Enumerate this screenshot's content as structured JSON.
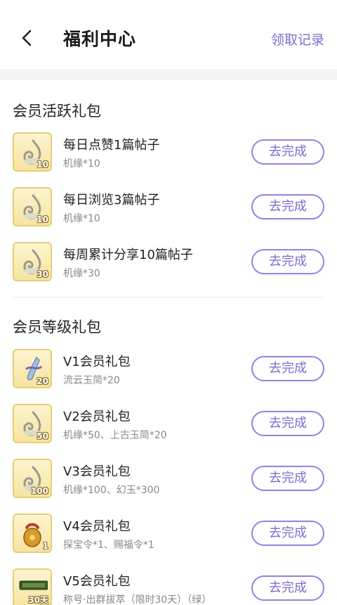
{
  "header": {
    "title": "福利中心",
    "records_label": "领取记录"
  },
  "sections": [
    {
      "title": "会员活跃礼包",
      "items": [
        {
          "title": "每日点赞1篇帖子",
          "reward": "机缘*10",
          "badge": "10",
          "button": "去完成",
          "icon": "swirl-token-icon"
        },
        {
          "title": "每日浏览3篇帖子",
          "reward": "机缘*10",
          "badge": "10",
          "button": "去完成",
          "icon": "swirl-token-icon"
        },
        {
          "title": "每周累计分享10篇帖子",
          "reward": "机缘*30",
          "badge": "30",
          "button": "去完成",
          "icon": "swirl-token-icon"
        }
      ]
    },
    {
      "title": "会员等级礼包",
      "items": [
        {
          "title": "V1会员礼包",
          "reward": "流云玉简*20",
          "badge": "20",
          "button": "去完成",
          "icon": "jade-scroll-icon"
        },
        {
          "title": "V2会员礼包",
          "reward": "机缘*50、上古玉简*20",
          "badge": "50",
          "button": "去完成",
          "icon": "swirl-token-icon"
        },
        {
          "title": "V3会员礼包",
          "reward": "机缘*100、幻玉*300",
          "badge": "100",
          "button": "去完成",
          "icon": "swirl-token-icon"
        },
        {
          "title": "V4会员礼包",
          "reward": "探宝令*1、赐福令*1",
          "badge": "1",
          "button": "去完成",
          "icon": "treasure-bag-icon"
        },
        {
          "title": "V5会员礼包",
          "reward": "称号·出群拔萃（限时30天）（绿）",
          "badge": "30天",
          "button": "去完成",
          "icon": "title-plaque-icon"
        }
      ]
    }
  ]
}
